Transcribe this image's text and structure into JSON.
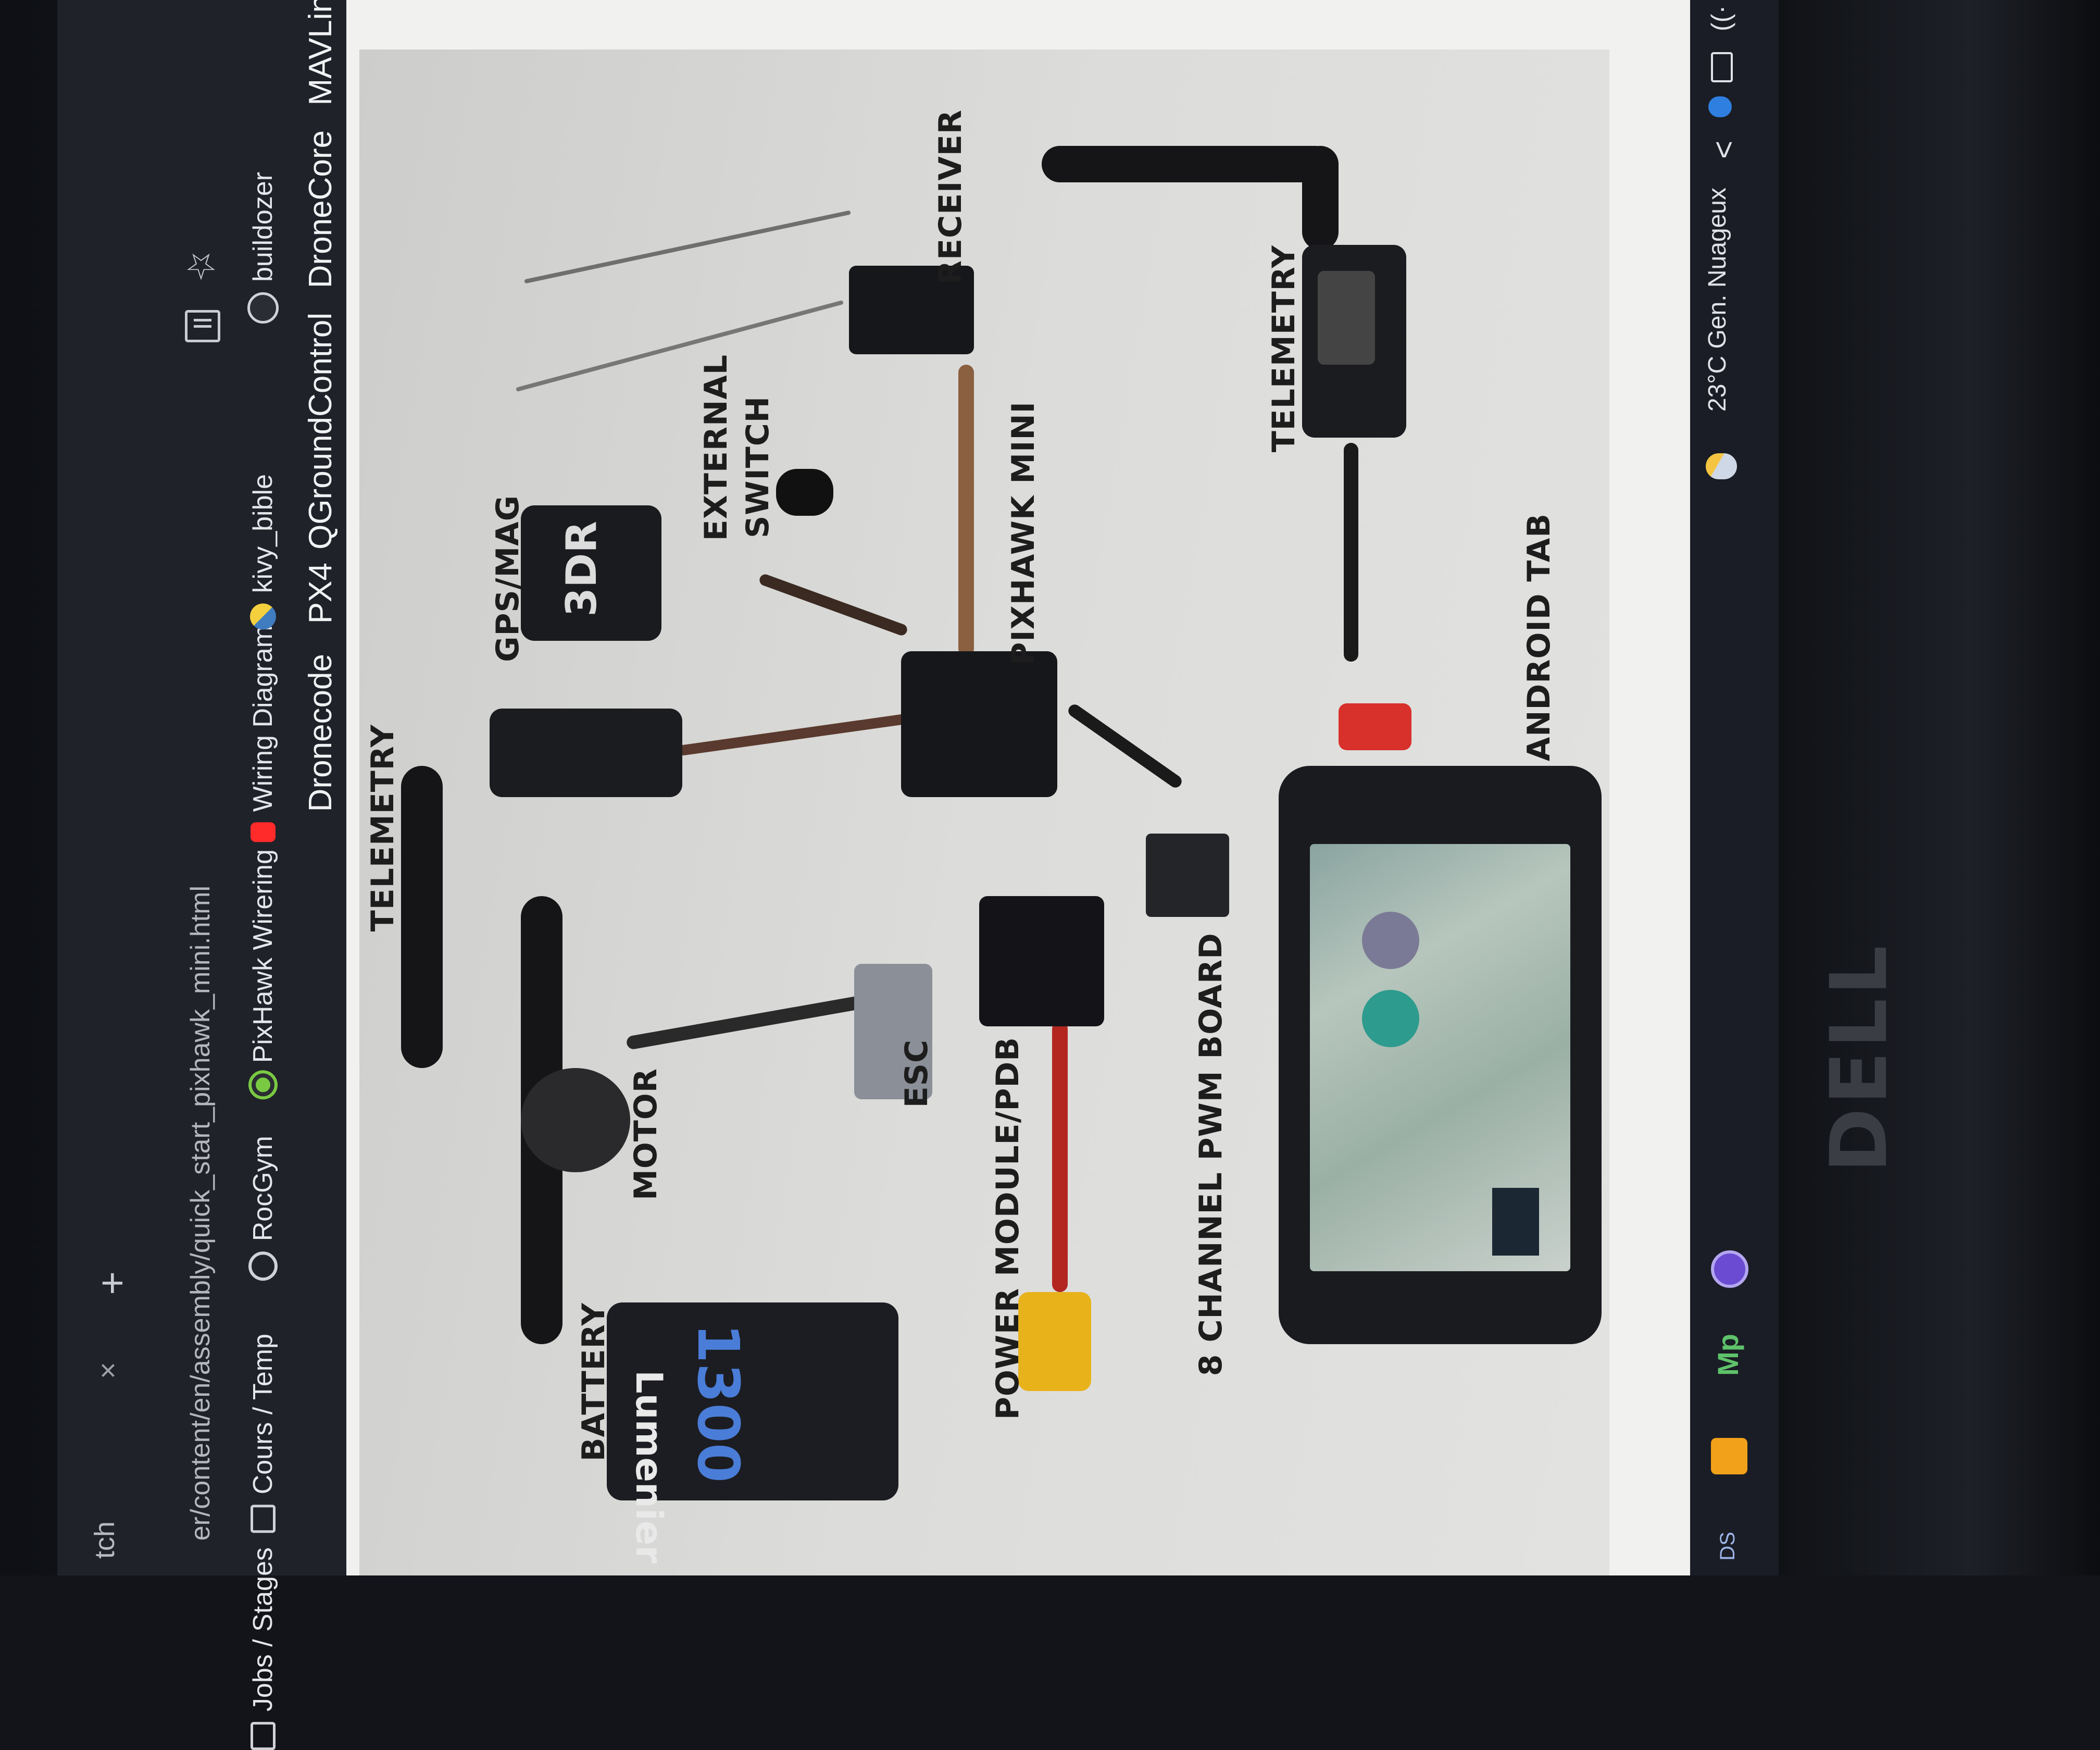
{
  "browser": {
    "tab_title": "tch",
    "tab_close": "×",
    "new_tab": "+",
    "url": "er/content/en/assembly/quick_start_pixhawk_mini.html",
    "bookmarks_row1": [
      {
        "label": "Jobs / Stages",
        "icon": "folder-icon"
      },
      {
        "label": "Cours / Temp",
        "icon": "folder-icon"
      },
      {
        "label": "RocGym",
        "icon": "globe-icon"
      },
      {
        "label": "PixHawk Wirering",
        "icon": "green-circle-icon"
      },
      {
        "label": "Wiring Diagram",
        "icon": "youtube-icon"
      },
      {
        "label": "kivy_bible",
        "icon": "python-icon"
      },
      {
        "label": "buildozer",
        "icon": "wordpress-icon"
      }
    ],
    "bookmarks_row2": [
      "Dronecode",
      "PX4",
      "QGroundControl",
      "DroneCore",
      "MAVLin"
    ]
  },
  "diagram": {
    "labels": {
      "telemetry_left": "TELEMETRY",
      "gps_mag": "GPS/MAG",
      "external_switch_1": "EXTERNAL",
      "external_switch_2": "SWITCH",
      "receiver": "RECEIVER",
      "pixhawk_mini": "PIXHAWK MINI",
      "telemetry_right": "TELEMETRY",
      "android_tab": "ANDROID TAB",
      "motor": "MOTOR",
      "esc": "ESC",
      "power_module": "POWER MODULE/PDB",
      "pwm_board": "8 CHANNEL PWM BOARD",
      "battery": "BATTERY"
    },
    "battery_brand": "Lumenier",
    "battery_capacity": "1300",
    "gps_brand": "3DR"
  },
  "taskbar": {
    "weather": "23°C Gen. Nuageux",
    "chevron": "<",
    "wifi": "((·",
    "app_mp": "Mp",
    "ds": "DS"
  },
  "bezel": {
    "logo": "DELL"
  }
}
